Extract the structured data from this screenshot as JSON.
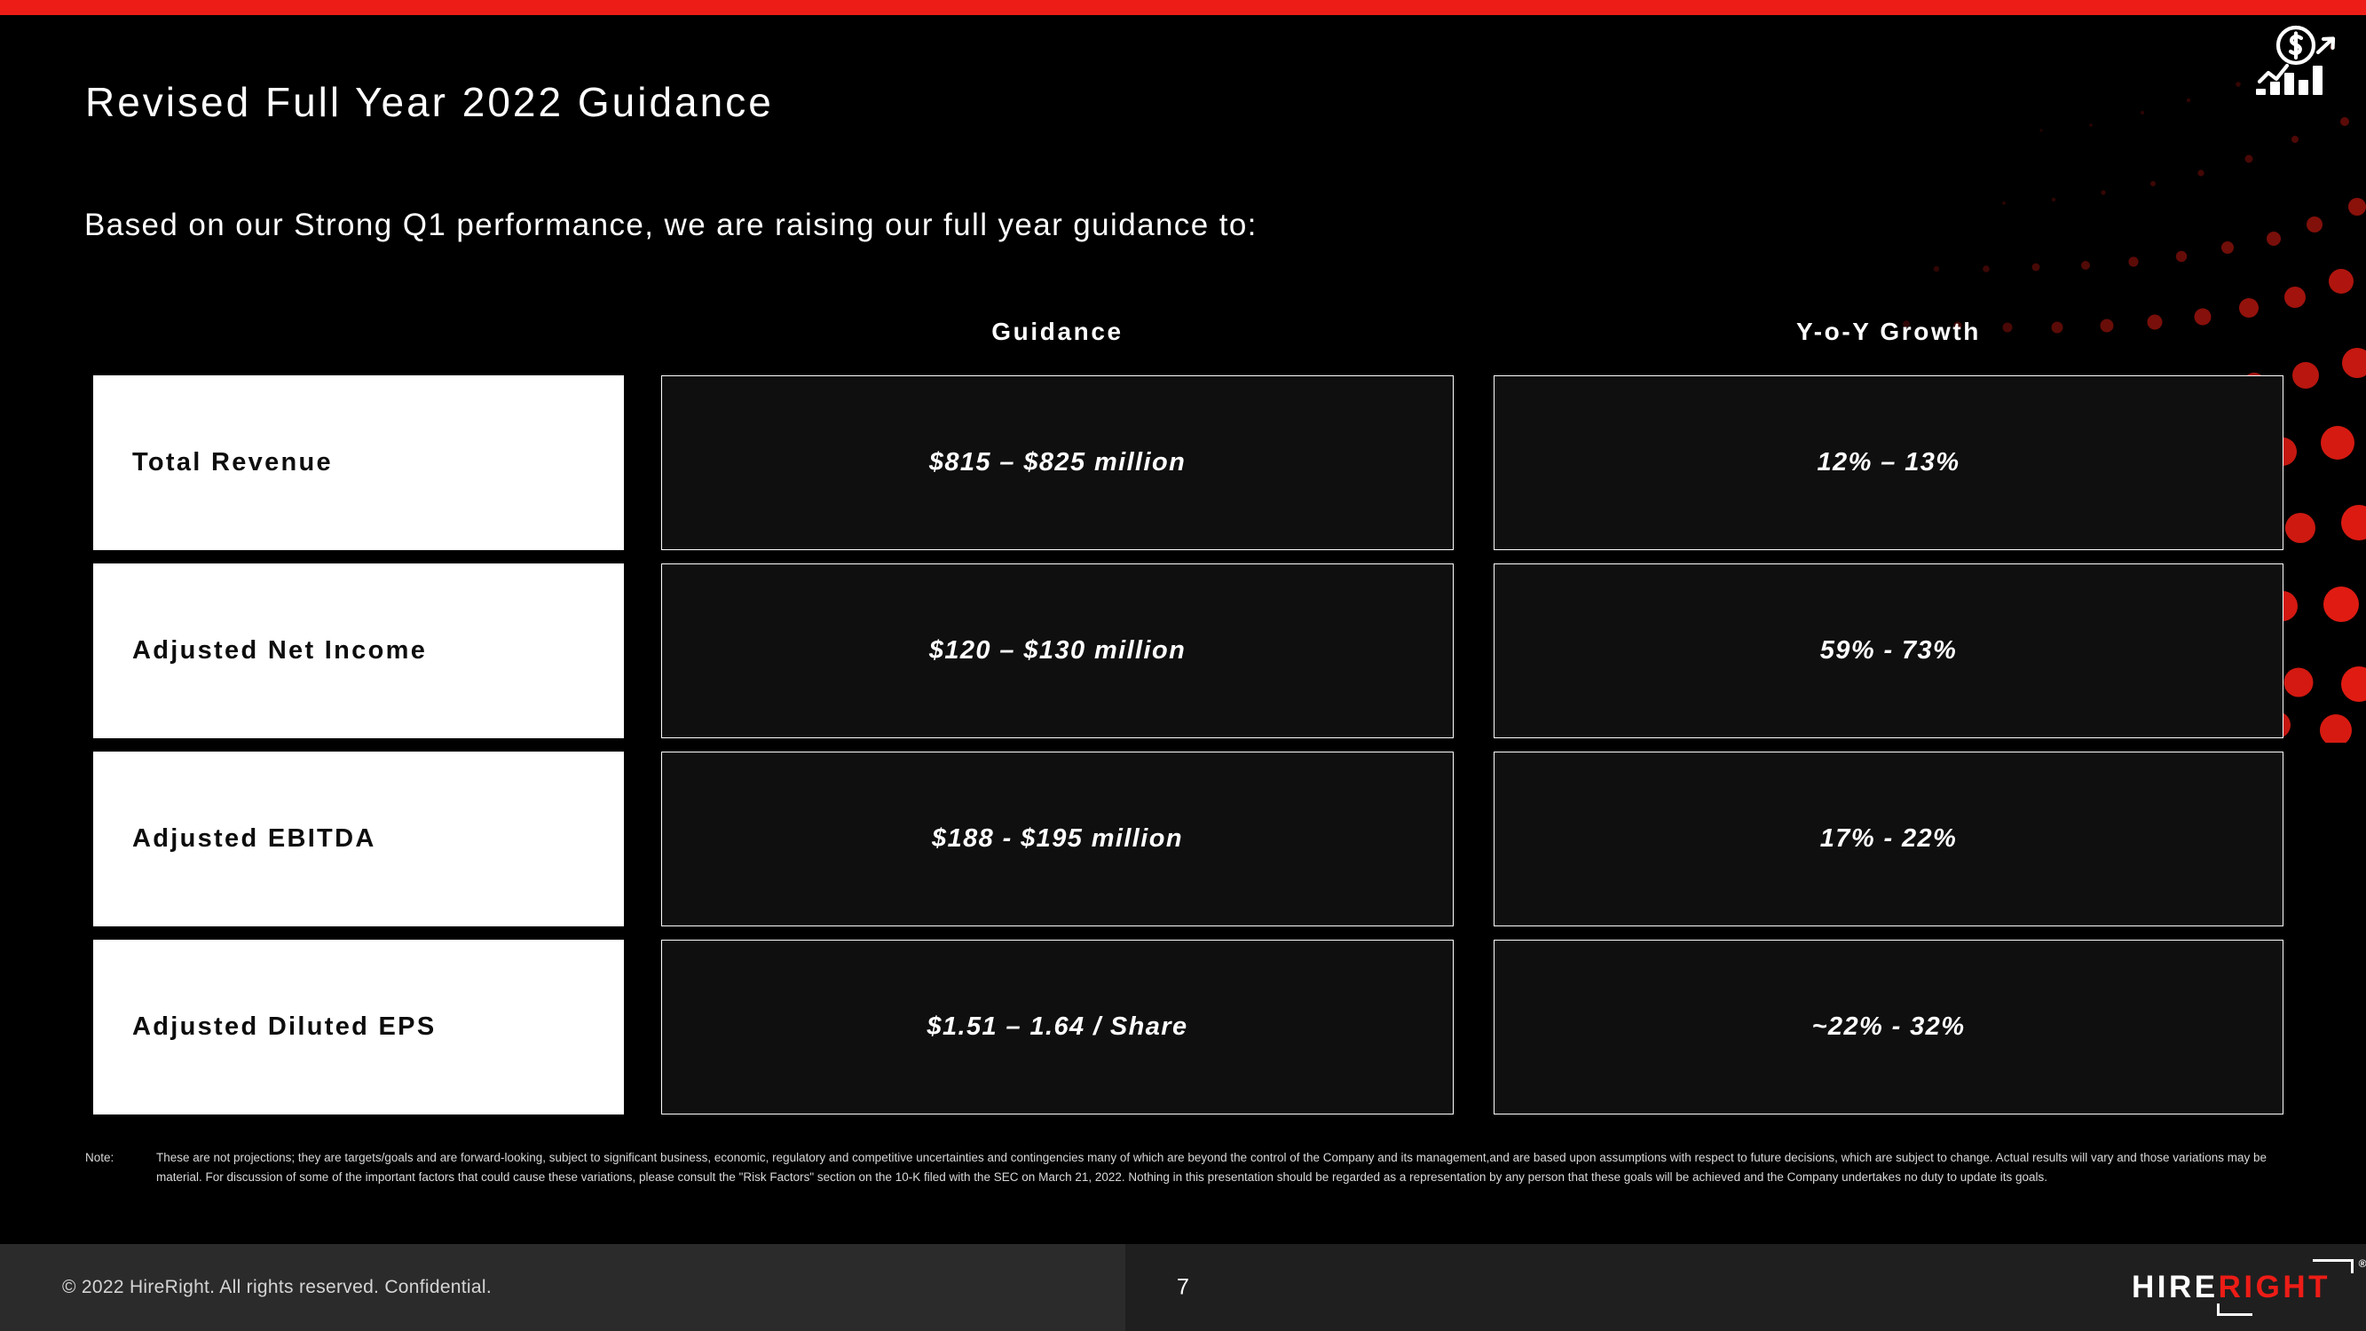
{
  "brand": {
    "accent_red": "#ED1C16",
    "background": "#000000",
    "logo_hire": "HIRE",
    "logo_right": "RIGHT",
    "registered_mark": "®"
  },
  "decor": {
    "corner_icon_name": "dollar-growth-chart-icon",
    "dot_pattern_name": "red-dot-gradient-pattern"
  },
  "header": {
    "title": "Revised Full Year 2022 Guidance",
    "subtitle": "Based on our Strong Q1 performance, we are raising our full year guidance to:"
  },
  "table": {
    "columns": [
      "",
      "Guidance",
      "Y-o-Y Growth"
    ],
    "rows": [
      {
        "label": "Total Revenue",
        "guidance": "$815 – $825 million",
        "yoy": "12% – 13%"
      },
      {
        "label": "Adjusted Net Income",
        "guidance": "$120 – $130 million",
        "yoy": "59% - 73%"
      },
      {
        "label": "Adjusted EBITDA",
        "guidance": "$188 - $195 million",
        "yoy": "17% - 22%"
      },
      {
        "label": "Adjusted Diluted EPS",
        "guidance": "$1.51 – 1.64 / Share",
        "yoy": "~22% - 32%"
      }
    ]
  },
  "footnote": {
    "label": "Note:",
    "body": "These are not projections; they are targets/goals and are forward-looking, subject to significant business, economic, regulatory and competitive uncertainties and contingencies many of which are beyond the control of the Company and its management,and are based upon assumptions with respect to future    decisions, which are subject to change. Actual results will vary and those variations may be material. For discussion of some of the important factors that could cause these variations, please consult the \"Risk Factors\" section on the 10-K filed with the SEC on March 21, 2022. Nothing in this presentation should be regarded as a representation by any person that these goals will be achieved and the Company undertakes no duty to update its goals."
  },
  "footer": {
    "copyright": "© 2022 HireRight. All rights reserved. Confidential.",
    "page_number": "7"
  }
}
